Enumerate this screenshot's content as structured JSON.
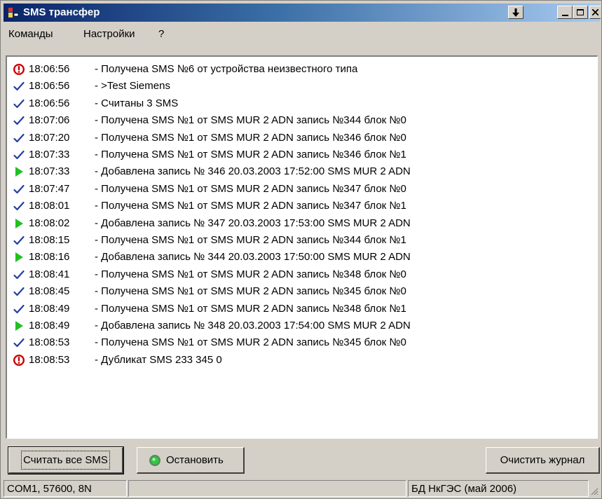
{
  "window": {
    "title": "SMS трансфер",
    "colors": {
      "title_start": "#0a246a",
      "title_end": "#a6caf0",
      "face": "#d4d0c8"
    }
  },
  "menu": [
    "Команды",
    "Настройки",
    "?"
  ],
  "log": [
    {
      "icon": "error",
      "time": "18:06:56",
      "message": "- Получена SMS №6 от устройства неизвестного типа"
    },
    {
      "icon": "check",
      "time": "18:06:56",
      "message": "- >Test Siemens"
    },
    {
      "icon": "check",
      "time": "18:06:56",
      "message": "- Считаны 3 SMS"
    },
    {
      "icon": "check",
      "time": "18:07:06",
      "message": "- Получена SMS №1 от SMS MUR 2 ADN запись №344 блок №0"
    },
    {
      "icon": "check",
      "time": "18:07:20",
      "message": "- Получена SMS №1 от SMS MUR 2 ADN запись №346 блок №0"
    },
    {
      "icon": "check",
      "time": "18:07:33",
      "message": "- Получена SMS №1 от SMS MUR 2 ADN запись №346 блок №1"
    },
    {
      "icon": "play",
      "time": "18:07:33",
      "message": "- Добавлена запись № 346 20.03.2003 17:52:00 SMS MUR 2 ADN"
    },
    {
      "icon": "check",
      "time": "18:07:47",
      "message": "- Получена SMS №1 от SMS MUR 2 ADN запись №347 блок №0"
    },
    {
      "icon": "check",
      "time": "18:08:01",
      "message": "- Получена SMS №1 от SMS MUR 2 ADN запись №347 блок №1"
    },
    {
      "icon": "play",
      "time": "18:08:02",
      "message": "- Добавлена запись № 347 20.03.2003 17:53:00 SMS MUR 2 ADN"
    },
    {
      "icon": "check",
      "time": "18:08:15",
      "message": "- Получена SMS №1 от SMS MUR 2 ADN запись №344 блок №1"
    },
    {
      "icon": "play",
      "time": "18:08:16",
      "message": "- Добавлена запись № 344 20.03.2003 17:50:00 SMS MUR 2 ADN"
    },
    {
      "icon": "check",
      "time": "18:08:41",
      "message": "- Получена SMS №1 от SMS MUR 2 ADN запись №348 блок №0"
    },
    {
      "icon": "check",
      "time": "18:08:45",
      "message": "- Получена SMS №1 от SMS MUR 2 ADN запись №345 блок №0"
    },
    {
      "icon": "check",
      "time": "18:08:49",
      "message": "- Получена SMS №1 от SMS MUR 2 ADN запись №348 блок №1"
    },
    {
      "icon": "play",
      "time": "18:08:49",
      "message": "- Добавлена запись № 348 20.03.2003 17:54:00 SMS MUR 2 ADN"
    },
    {
      "icon": "check",
      "time": "18:08:53",
      "message": "- Получена SMS №1 от SMS MUR 2 ADN запись №345 блок №0"
    },
    {
      "icon": "error",
      "time": "18:08:53",
      "message": "- Дубликат SMS 233 345 0"
    }
  ],
  "icon_colors": {
    "error": "#cc0000",
    "check": "#1f3fa0",
    "play": "#22c022",
    "led": "#2ecc40"
  },
  "buttons": {
    "read_all": "Считать все SMS",
    "stop": "Остановить",
    "clear_log": "Очистить журнал"
  },
  "status": {
    "port": "COM1, 57600, 8N",
    "middle": "",
    "database": "БД НкГЭС (май 2006)"
  }
}
